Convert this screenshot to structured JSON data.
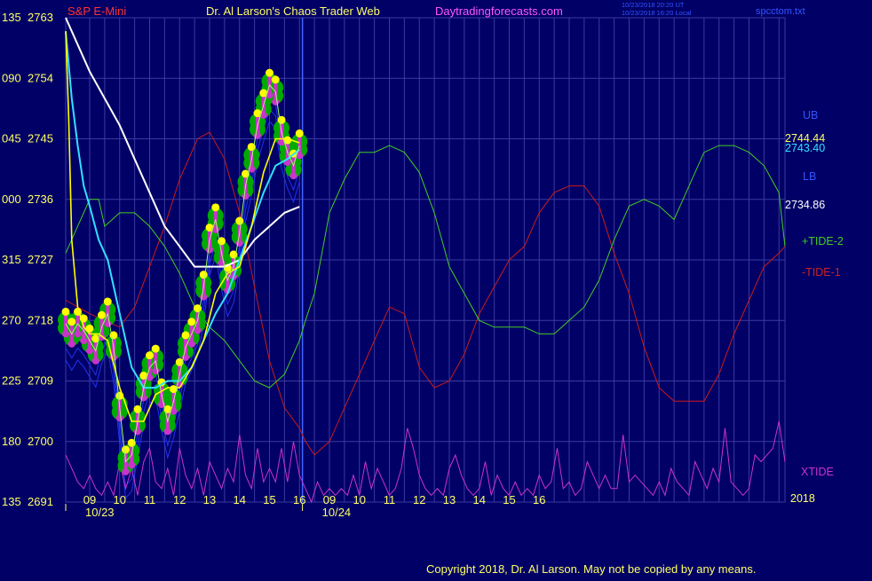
{
  "header": {
    "instrument": "S&P E-Mini",
    "site": "Dr. Al Larson's Chaos Trader Web",
    "url": "Daytradingforecasts.com",
    "stamp1": "10/23/2018 20:20 UT",
    "stamp2": "10/23/2018 16:20 Local",
    "file": "spcctom.txt"
  },
  "copyright": "Copyright 2018, Dr. Al Larson. May not be copied by any means.",
  "year_label": "2018",
  "colors": {
    "background": "#000066",
    "grid": "#3a3aa0",
    "text": "#ffff66",
    "price": "#ffff00",
    "glow": "#00aa00",
    "white": "#ffffff",
    "cyan": "#33e0ff",
    "tide1": "#cc1a1a",
    "tide2": "#44cc22",
    "xtide": "#cc33cc",
    "blue": "#2233ee"
  },
  "chart_data": {
    "type": "line",
    "title": "S&P E-Mini",
    "xlabel": "",
    "ylabel": "",
    "y_left_ticks": [
      "135",
      "090",
      "045",
      "000",
      "315",
      "270",
      "225",
      "180",
      "135"
    ],
    "y_right_ticks": [
      "2763",
      "2754",
      "2745",
      "2736",
      "2727",
      "2718",
      "2709",
      "2700",
      "2691"
    ],
    "ylim": [
      2691,
      2763
    ],
    "x_hour_ticks": [
      "09",
      "10",
      "11",
      "12",
      "13",
      "14",
      "15",
      "16",
      "09",
      "10",
      "11",
      "12",
      "13",
      "14",
      "15",
      "16"
    ],
    "x_date_labels": [
      "10/23",
      "10/24"
    ],
    "x_range_hours": [
      8.2,
      32.2
    ],
    "right_labels": {
      "ub": "UB",
      "lb": "LB",
      "upper_value": "2744.44",
      "cyan_value": "2743.40",
      "white_value": "2734.86",
      "tide2": "+TIDE-2",
      "tide1": "-TIDE-1",
      "xtide": "XTIDE"
    },
    "series": [
      {
        "name": "Price",
        "x": [
          8.2,
          8.4,
          8.6,
          8.8,
          9.0,
          9.2,
          9.4,
          9.6,
          9.8,
          10.0,
          10.2,
          10.4,
          10.6,
          10.8,
          11.0,
          11.2,
          11.4,
          11.6,
          11.8,
          12.0,
          12.2,
          12.4,
          12.6,
          12.8,
          13.0,
          13.2,
          13.4,
          13.6,
          13.8,
          14.0,
          14.2,
          14.4,
          14.6,
          14.8,
          15.0,
          15.2,
          15.4,
          15.6,
          15.8,
          16.0
        ],
        "values": [
          2717.5,
          2716,
          2717.5,
          2716.5,
          2715,
          2713.5,
          2717,
          2719,
          2714,
          2705,
          2697,
          2698,
          2703,
          2708,
          2711,
          2712,
          2707,
          2703,
          2706,
          2710,
          2714,
          2716,
          2718,
          2723,
          2730,
          2733,
          2728,
          2724,
          2726,
          2731,
          2738,
          2742,
          2747,
          2750,
          2753,
          2752,
          2746,
          2743,
          2741,
          2744
        ]
      },
      {
        "name": "",
        "x": [
          8.2,
          8.3,
          8.4,
          8.6,
          8.8,
          9.0,
          9.3,
          9.6,
          10.0,
          10.4,
          10.8,
          11.2,
          11.6,
          12.0,
          12.4,
          12.8,
          13.2,
          13.6,
          14.0,
          14.4,
          14.8,
          15.2,
          15.6,
          16.0
        ],
        "values": [
          2761,
          2748,
          2730,
          2720,
          2717,
          2716,
          2716,
          2715,
          2708,
          2703,
          2703,
          2707,
          2708,
          2708,
          2711,
          2715,
          2722,
          2725,
          2726,
          2732,
          2740,
          2745,
          2745,
          2744.4
        ]
      },
      {
        "name": "",
        "x": [
          8.2,
          8.4,
          8.6,
          8.8,
          9.0,
          9.3,
          9.6,
          10.0,
          10.4,
          10.8,
          11.2,
          11.6,
          12.0,
          12.4,
          12.8,
          13.2,
          13.6,
          14.0,
          14.4,
          14.8,
          15.2,
          15.6,
          16.0
        ],
        "values": [
          2761,
          2751,
          2744,
          2738,
          2735,
          2730,
          2727,
          2719,
          2711,
          2708,
          2708,
          2709,
          2709,
          2711,
          2715,
          2719,
          2722,
          2727,
          2732,
          2737,
          2741,
          2742,
          2743.4
        ]
      },
      {
        "name": "",
        "x": [
          8.2,
          8.6,
          9.0,
          9.5,
          10.0,
          10.5,
          11.0,
          11.5,
          12.0,
          12.5,
          13.0,
          13.5,
          14.0,
          14.5,
          15.0,
          15.5,
          16.0
        ],
        "values": [
          2763,
          2759,
          2755,
          2751,
          2747,
          2742,
          2737,
          2732,
          2729,
          2726,
          2726,
          2726,
          2727,
          2730,
          2732,
          2734,
          2734.9
        ]
      },
      {
        "name": "TIDE-1",
        "x": [
          8.2,
          9.0,
          9.5,
          10.0,
          10.5,
          11.0,
          11.5,
          12.0,
          12.3,
          12.6,
          13.0,
          13.5,
          14.0,
          14.5,
          15.0,
          15.5,
          16.0,
          16.2,
          16.5,
          17.0,
          17.5,
          18.0,
          18.5,
          19.0,
          19.5,
          20.0,
          20.5,
          21.0,
          21.5,
          22.0,
          22.5,
          23.0,
          23.5,
          24.0,
          24.5,
          25.0,
          25.5,
          26.0,
          26.5,
          27.0,
          27.5,
          28.0,
          28.5,
          29.0,
          29.5,
          30.0,
          30.5,
          31.0,
          31.5,
          32.0,
          32.2
        ],
        "values": [
          2721,
          2719,
          2718,
          2717,
          2720,
          2726,
          2732,
          2739,
          2742,
          2745,
          2746,
          2742,
          2734,
          2723,
          2712,
          2705,
          2702,
          2700,
          2698,
          2700,
          2705,
          2710,
          2715,
          2720,
          2719,
          2711,
          2708,
          2709,
          2713,
          2719,
          2723,
          2727,
          2729,
          2734,
          2737,
          2738,
          2738,
          2735,
          2728,
          2722,
          2714,
          2708,
          2706,
          2706,
          2706,
          2710,
          2716,
          2721,
          2726,
          2728,
          2729
        ]
      },
      {
        "name": "TIDE-2",
        "x": [
          8.2,
          8.5,
          9.0,
          9.3,
          9.5,
          10.0,
          10.5,
          11.0,
          11.5,
          12.0,
          12.5,
          13.0,
          13.5,
          14.0,
          14.5,
          15.0,
          15.5,
          16.0,
          16.2,
          16.5,
          17.0,
          17.5,
          18.0,
          18.5,
          19.0,
          19.5,
          20.0,
          20.5,
          21.0,
          21.5,
          22.0,
          22.5,
          23.0,
          23.5,
          24.0,
          24.5,
          25.0,
          25.5,
          26.0,
          26.5,
          27.0,
          27.5,
          28.0,
          28.5,
          29.0,
          29.5,
          30.0,
          30.5,
          31.0,
          31.5,
          32.0,
          32.2
        ],
        "values": [
          2728,
          2731,
          2736,
          2736,
          2732,
          2734,
          2734,
          2732,
          2729,
          2725,
          2720,
          2717,
          2715,
          2712,
          2709,
          2708,
          2710,
          2715,
          2718,
          2722,
          2734,
          2739,
          2743,
          2743,
          2744,
          2743,
          2740,
          2734,
          2726,
          2722,
          2718,
          2717,
          2717,
          2717,
          2716,
          2716,
          2718,
          2720,
          2724,
          2730,
          2735,
          2736,
          2735,
          2733,
          2738,
          2743,
          2744,
          2744,
          2743,
          2741,
          2737,
          2729
        ]
      },
      {
        "name": "XTIDE",
        "x": [
          8.2,
          8.4,
          8.6,
          8.8,
          9.0,
          9.2,
          9.4,
          9.6,
          9.8,
          10.0,
          10.2,
          10.4,
          10.6,
          10.8,
          11.0,
          11.2,
          11.4,
          11.6,
          11.8,
          12.0,
          12.2,
          12.4,
          12.6,
          12.8,
          13.0,
          13.2,
          13.4,
          13.6,
          13.8,
          14.0,
          14.2,
          14.4,
          14.6,
          14.8,
          15.0,
          15.2,
          15.4,
          15.6,
          15.8,
          16.0,
          16.2,
          16.4,
          16.6,
          16.8,
          17.0,
          17.2,
          17.4,
          17.6,
          17.8,
          18.0,
          18.2,
          18.4,
          18.6,
          18.8,
          19.0,
          19.2,
          19.4,
          19.6,
          19.8,
          20.0,
          20.2,
          20.4,
          20.6,
          20.8,
          21.0,
          21.2,
          21.4,
          21.6,
          21.8,
          22.0,
          22.2,
          22.4,
          22.6,
          22.8,
          23.0,
          23.2,
          23.4,
          23.6,
          23.8,
          24.0,
          24.2,
          24.4,
          24.6,
          24.8,
          25.0,
          25.2,
          25.4,
          25.6,
          25.8,
          26.0,
          26.2,
          26.4,
          26.6,
          26.8,
          27.0,
          27.2,
          27.4,
          27.6,
          27.8,
          28.0,
          28.2,
          28.4,
          28.6,
          28.8,
          29.0,
          29.2,
          29.4,
          29.6,
          29.8,
          30.0,
          30.2,
          30.4,
          30.6,
          30.8,
          31.0,
          31.2,
          31.4,
          31.6,
          31.8,
          32.0,
          32.2
        ],
        "values": [
          2698,
          2696,
          2694,
          2693,
          2695,
          2693,
          2692,
          2694,
          2692,
          2697,
          2693,
          2696,
          2692,
          2697,
          2699,
          2694,
          2693,
          2696,
          2692,
          2699,
          2695,
          2693,
          2696,
          2692,
          2697,
          2695,
          2693,
          2696,
          2694,
          2701,
          2695,
          2693,
          2699,
          2694,
          2696,
          2694,
          2699,
          2694,
          2700,
          2695,
          2693,
          2691,
          2694,
          2692,
          2693,
          2692,
          2693,
          2692,
          2695,
          2692,
          2697,
          2693,
          2696,
          2694,
          2692,
          2693,
          2696,
          2702,
          2699,
          2695,
          2693,
          2692,
          2693,
          2692,
          2696,
          2698,
          2695,
          2693,
          2692,
          2693,
          2697,
          2692,
          2695,
          2693,
          2692,
          2694,
          2692,
          2693,
          2692,
          2695,
          2693,
          2694,
          2699,
          2693,
          2694,
          2692,
          2693,
          2697,
          2695,
          2693,
          2695,
          2693,
          2693,
          2701,
          2694,
          2695,
          2694,
          2693,
          2692,
          2694,
          2692,
          2696,
          2694,
          2693,
          2692,
          2697,
          2695,
          2693,
          2696,
          2694,
          2702,
          2694,
          2693,
          2692,
          2693,
          2698,
          2697,
          2698,
          2699,
          2703,
          2697
        ]
      }
    ]
  }
}
